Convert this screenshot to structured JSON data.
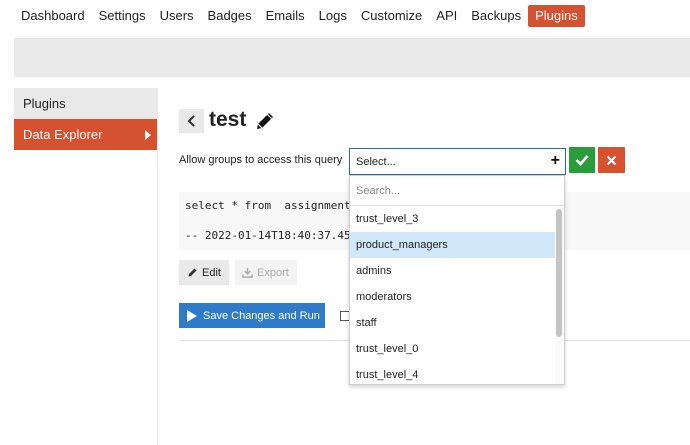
{
  "nav": {
    "items": [
      "Dashboard",
      "Settings",
      "Users",
      "Badges",
      "Emails",
      "Logs",
      "Customize",
      "API",
      "Backups",
      "Plugins"
    ],
    "active": "Plugins"
  },
  "sidebar": {
    "items": [
      {
        "label": "Plugins"
      },
      {
        "label": "Data Explorer"
      }
    ]
  },
  "query": {
    "title": "test",
    "groups_label": "Allow groups to access this query",
    "select_value": "Select...",
    "sql_line1": "select * from  assignments",
    "sql_line2": "-- 2022-01-14T18:40:37.451"
  },
  "buttons": {
    "edit": "Edit",
    "export": "Export",
    "save_run": "Save Changes and Run"
  },
  "dropdown": {
    "search_placeholder": "Search...",
    "options": [
      "trust_level_3",
      "product_managers",
      "admins",
      "moderators",
      "staff",
      "trust_level_0",
      "trust_level_4"
    ],
    "highlighted": "product_managers"
  },
  "colors": {
    "accent": "#d6512f",
    "primary": "#2f7ac9",
    "success": "#2a9d3b",
    "highlight": "#d1e8fb"
  },
  "icons": [
    "chevron-left-icon",
    "pencil-icon",
    "plus-icon",
    "check-icon",
    "close-icon",
    "download-icon",
    "play-icon",
    "chevron-right-icon"
  ]
}
